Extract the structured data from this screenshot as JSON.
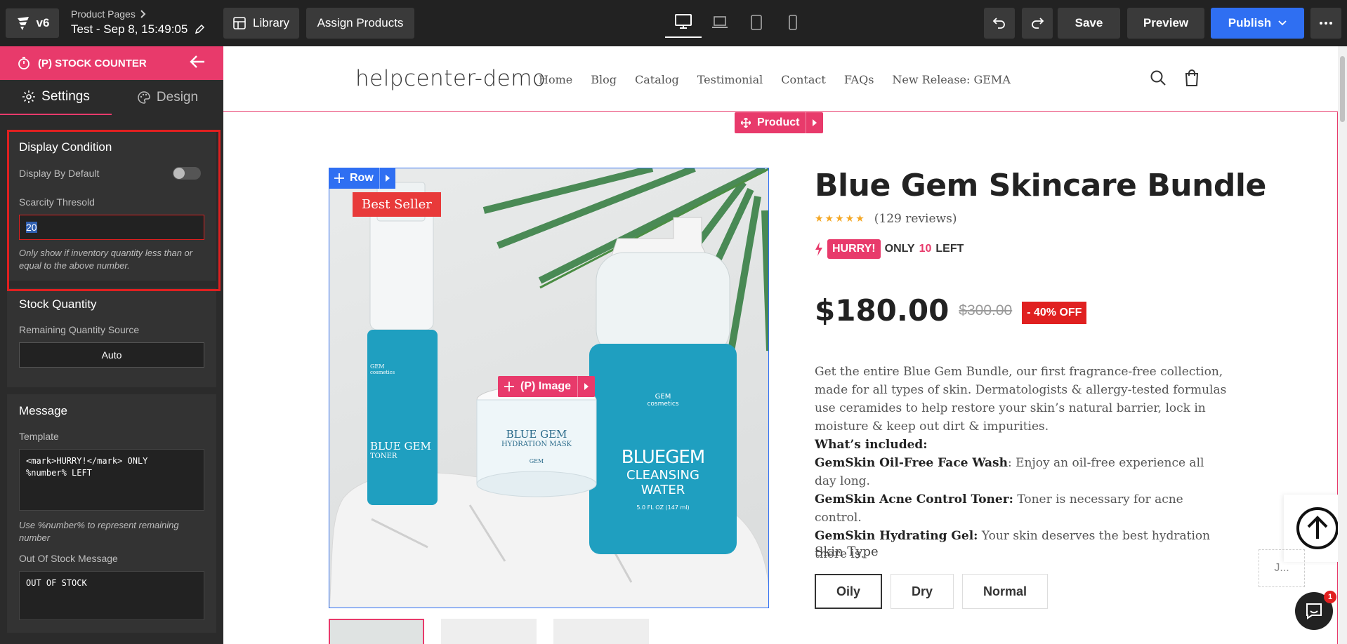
{
  "topbar": {
    "version": "v6",
    "crumb": "Product Pages",
    "page_title": "Test - Sep 8, 15:49:05",
    "library": "Library",
    "assign": "Assign Products",
    "save": "Save",
    "preview": "Preview",
    "publish": "Publish"
  },
  "sidebar": {
    "header": "(P) STOCK COUNTER",
    "tabs": [
      "Settings",
      "Design"
    ],
    "display_condition": {
      "title": "Display Condition",
      "display_default_label": "Display By Default",
      "display_default_on": false,
      "threshold_label": "Scarcity Thresold",
      "threshold_value": "20",
      "hint": "Only show if inventory quantity less than or equal to the above number."
    },
    "stock_quantity": {
      "title": "Stock Quantity",
      "source_label": "Remaining Quantity Source",
      "source_value": "Auto"
    },
    "message": {
      "title": "Message",
      "template_label": "Template",
      "template_value": "<mark>HURRY!</mark> ONLY\n%number% LEFT",
      "template_hint": "Use %number% to represent remaining number",
      "oos_label": "Out Of Stock Message",
      "oos_value": "OUT OF STOCK"
    }
  },
  "site": {
    "logo": "helpcenter-demo",
    "nav": [
      "Home",
      "Blog",
      "Catalog",
      "Testimonial",
      "Contact",
      "FAQs",
      "New Release: GEMA"
    ]
  },
  "editor": {
    "product_chip": "Product",
    "row_chip": "Row",
    "image_chip": "(P) Image"
  },
  "product": {
    "badge": "Best Seller",
    "title": "Blue Gem Skincare Bundle",
    "rating": 5,
    "reviews": "(129 reviews)",
    "hurry": "HURRY!",
    "only": "ONLY",
    "count": "10",
    "left": "LEFT",
    "price": "$180.00",
    "compare_price": "$300.00",
    "discount": "- 40% OFF",
    "description": "Get the entire Blue Gem Bundle, our first fragrance-free collection, made for all types of skin. Dermatologists & allergy-tested formulas use ceramides to help restore your skin’s natural barrier, lock in moisture & keep out dirt & impurities.",
    "included_title": "What’s included:",
    "items": [
      {
        "name": "GemSkin Oil-Free Face Wash",
        "sep": ":",
        "text": " Enjoy an oil-free experience all day long."
      },
      {
        "name": "GemSkin Acne Control Toner:",
        "sep": "",
        "text": " Toner is necessary for acne control."
      },
      {
        "name": "GemSkin Hydrating Gel:",
        "sep": "",
        "text": " Your skin deserves the best hydration there is."
      }
    ],
    "skin_label": "Skin Type",
    "skin_options": [
      "Oily",
      "Dry",
      "Normal"
    ],
    "image_labels": {
      "toner_brand": "GEM",
      "toner_brand_sub": "cosmetics",
      "toner_name": "BLUE GEM",
      "toner_sub": "TONER",
      "mask_name": "BLUE GEM",
      "mask_sub": "HYDRATION MASK",
      "mask_brand": "GEM",
      "bottle_brand": "GEM",
      "bottle_brand_sub": "cosmetics",
      "bottle_name": "BLUEGEM",
      "bottle_sub1": "CLEANSING",
      "bottle_sub2": "WATER",
      "bottle_size": "5.0 FL OZ (147 ml)"
    }
  },
  "floating": {
    "j_label": "J...",
    "chat_badge": "1"
  },
  "colors": {
    "accent": "#e83a6b",
    "publish": "#2f6ff2",
    "editor_blue": "#2f6ff2",
    "discount_red": "#e02020",
    "teal": "#1f9fc0"
  }
}
